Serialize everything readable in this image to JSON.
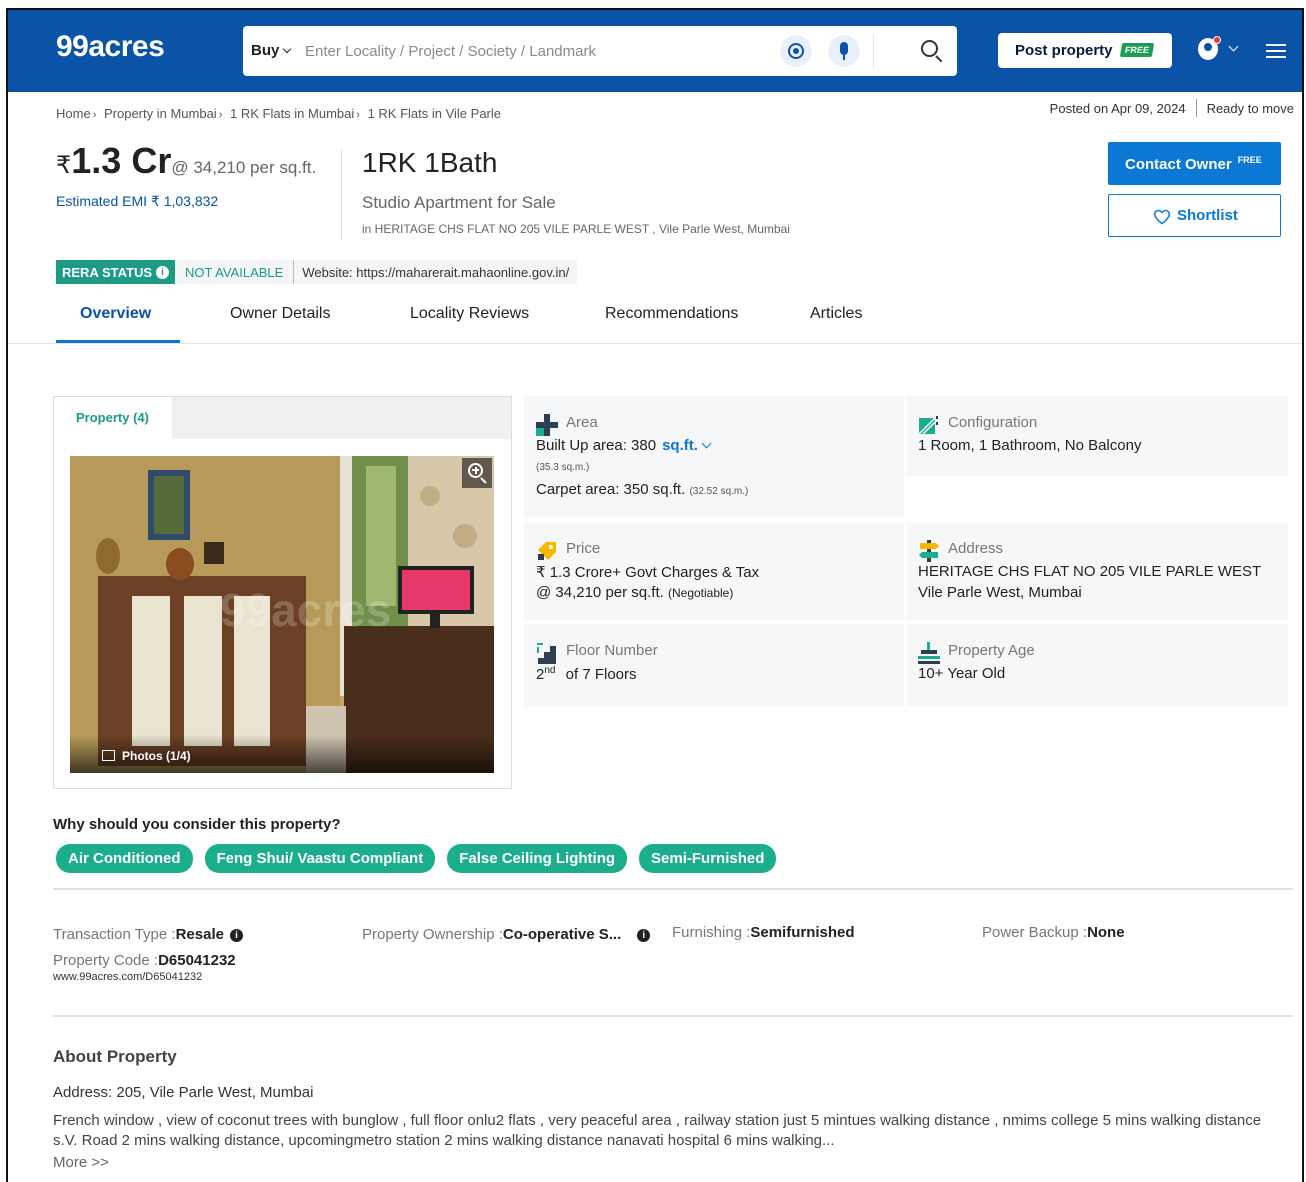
{
  "header": {
    "logo": "99acres",
    "buy_label": "Buy",
    "search_placeholder": "Enter Locality / Project / Society / Landmark",
    "post_property": "Post property",
    "free_tag": "FREE",
    "brand_color": "#0a53a6"
  },
  "breadcrumb": [
    "Home",
    "Property in Mumbai",
    "1 RK Flats in Mumbai",
    "1 RK Flats in Vile Parle"
  ],
  "meta": {
    "posted": "Posted on Apr 09, 2024",
    "status": "Ready to move"
  },
  "listing": {
    "currency": "₹",
    "price": "1.3 Cr",
    "per_sqft": "@ 34,210 per sq.ft.",
    "emi": "Estimated EMI ₹ 1,03,832",
    "bhk": "1RK 1Bath",
    "type": "Studio Apartment for Sale",
    "address": "in HERITAGE CHS FLAT NO 205 VILE PARLE WEST , Vile Parle West, Mumbai"
  },
  "actions": {
    "contact": "Contact Owner",
    "contact_sup": "FREE",
    "shortlist": "Shortlist"
  },
  "rera": {
    "label": "RERA STATUS",
    "info": "i",
    "status": "NOT AVAILABLE",
    "website": "Website: https://maharerait.mahaonline.gov.in/"
  },
  "tabs": [
    "Overview",
    "Owner Details",
    "Locality Reviews",
    "Recommendations",
    "Articles"
  ],
  "gallery": {
    "tab": "Property (4)",
    "photos": "Photos (1/4)"
  },
  "details": {
    "area": {
      "label": "Area",
      "built_up_prefix": "Built Up area: 380",
      "unit": "sq.ft.",
      "built_sqm": "(35.3 sq.m.)",
      "carpet": "Carpet area: 350 sq.ft.",
      "carpet_sqm": "(32.52 sq.m.)"
    },
    "configuration": {
      "label": "Configuration",
      "value": "1 Room, 1 Bathroom, No Balcony"
    },
    "price": {
      "label": "Price",
      "line1": "₹ 1.3 Crore+ Govt Charges & Tax",
      "line2": "@ 34,210 per sq.ft.",
      "negotiable": "(Negotiable)"
    },
    "address": {
      "label": "Address",
      "line1": "HERITAGE CHS FLAT NO 205 VILE PARLE WEST",
      "line2": "Vile Parle West, Mumbai"
    },
    "floor": {
      "label": "Floor Number",
      "num": "2",
      "suffix": "nd",
      "rest": "of 7 Floors"
    },
    "age": {
      "label": "Property Age",
      "value": "10+ Year Old"
    }
  },
  "why": {
    "title": "Why should you consider this property?",
    "chips": [
      "Air Conditioned",
      "Feng Shui/ Vaastu Compliant",
      "False Ceiling Lighting",
      "Semi-Furnished"
    ]
  },
  "attributes": {
    "transaction": {
      "k": "Transaction Type :",
      "v": "Resale"
    },
    "ownership": {
      "k": "Property Ownership :",
      "v": "Co-operative S..."
    },
    "furnishing": {
      "k": "Furnishing :",
      "v": "Semifurnished"
    },
    "backup": {
      "k": "Power Backup :",
      "v": "None"
    },
    "code": {
      "k": "Property Code :",
      "v": "D65041232"
    },
    "url": "www.99acres.com/D65041232"
  },
  "about": {
    "title": "About Property",
    "address": "Address: 205, Vile Parle West, Mumbai",
    "description": "French window , view of coconut trees with bunglow , full floor onlu2 flats , very peaceful area , railway station just 5 mintues walking distance , nmims college 5 mins walking distance s.V. Road 2 mins walking distance, upcomingmetro station 2 mins walking distance nanavati hospital 6 mins walking...",
    "more": "More >>"
  }
}
